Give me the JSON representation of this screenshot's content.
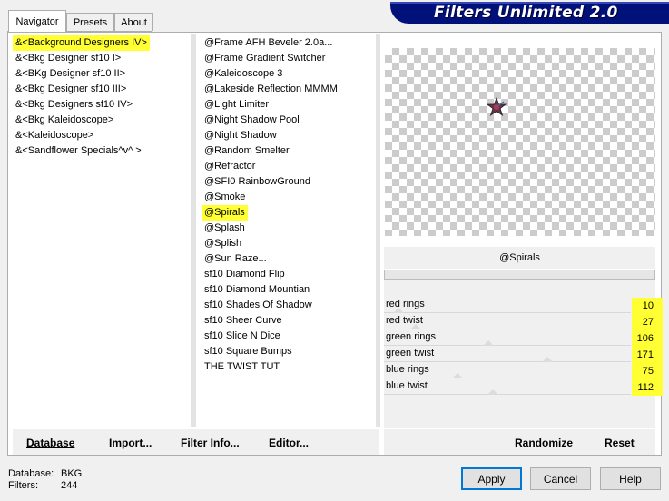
{
  "tabs": [
    {
      "label": "Navigator",
      "active": true
    },
    {
      "label": "Presets",
      "active": false
    },
    {
      "label": "About",
      "active": false
    }
  ],
  "app_title": "Filters Unlimited 2.0",
  "categories": [
    {
      "label": "&<Background Designers IV>",
      "selected": true
    },
    {
      "label": "&<Bkg Designer sf10 I>",
      "selected": false
    },
    {
      "label": "&<BKg Designer sf10 II>",
      "selected": false
    },
    {
      "label": "&<Bkg Designer sf10 III>",
      "selected": false
    },
    {
      "label": "&<Bkg Designers sf10 IV>",
      "selected": false
    },
    {
      "label": "&<Bkg Kaleidoscope>",
      "selected": false
    },
    {
      "label": "&<Kaleidoscope>",
      "selected": false
    },
    {
      "label": "&<Sandflower Specials^v^ >",
      "selected": false
    }
  ],
  "filters": [
    {
      "label": "@Frame AFH Beveler 2.0a...",
      "selected": false
    },
    {
      "label": "@Frame Gradient Switcher",
      "selected": false
    },
    {
      "label": "@Kaleidoscope 3",
      "selected": false
    },
    {
      "label": "@Lakeside Reflection MMMM",
      "selected": false
    },
    {
      "label": "@Light Limiter",
      "selected": false
    },
    {
      "label": "@Night Shadow Pool",
      "selected": false
    },
    {
      "label": "@Night Shadow",
      "selected": false
    },
    {
      "label": "@Random Smelter",
      "selected": false
    },
    {
      "label": "@Refractor",
      "selected": false
    },
    {
      "label": "@SFI0 RainbowGround",
      "selected": false
    },
    {
      "label": "@Smoke",
      "selected": false
    },
    {
      "label": "@Spirals",
      "selected": true
    },
    {
      "label": "@Splash",
      "selected": false
    },
    {
      "label": "@Splish",
      "selected": false
    },
    {
      "label": "@Sun Raze...",
      "selected": false
    },
    {
      "label": "sf10 Diamond Flip",
      "selected": false
    },
    {
      "label": "sf10 Diamond Mountian",
      "selected": false
    },
    {
      "label": "sf10 Shades Of Shadow",
      "selected": false
    },
    {
      "label": "sf10 Sheer Curve",
      "selected": false
    },
    {
      "label": "sf10 Slice N Dice",
      "selected": false
    },
    {
      "label": "sf10 Square Bumps",
      "selected": false
    },
    {
      "label": "THE TWIST TUT",
      "selected": false
    }
  ],
  "current_filter": "@Spirals",
  "params": [
    {
      "label": "red rings",
      "value": "10",
      "level": 0.04
    },
    {
      "label": "red twist",
      "value": "27",
      "level": 0.11
    },
    {
      "label": "green rings",
      "value": "106",
      "level": 0.42
    },
    {
      "label": "green twist",
      "value": "171",
      "level": 0.67
    },
    {
      "label": "blue rings",
      "value": "75",
      "level": 0.29
    },
    {
      "label": "blue twist",
      "value": "112",
      "level": 0.44
    }
  ],
  "buttons": {
    "database": "Database",
    "import": "Import...",
    "filter_info": "Filter Info...",
    "editor": "Editor...",
    "randomize": "Randomize",
    "reset": "Reset",
    "apply": "Apply",
    "cancel": "Cancel",
    "help": "Help"
  },
  "status": {
    "database_label": "Database:",
    "database_value": "BKG",
    "filters_label": "Filters:",
    "filters_value": "244"
  },
  "colors": {
    "selection": "#ffff33",
    "banner": "#00127a"
  },
  "icons": {
    "preview_shape": "star-icon"
  }
}
